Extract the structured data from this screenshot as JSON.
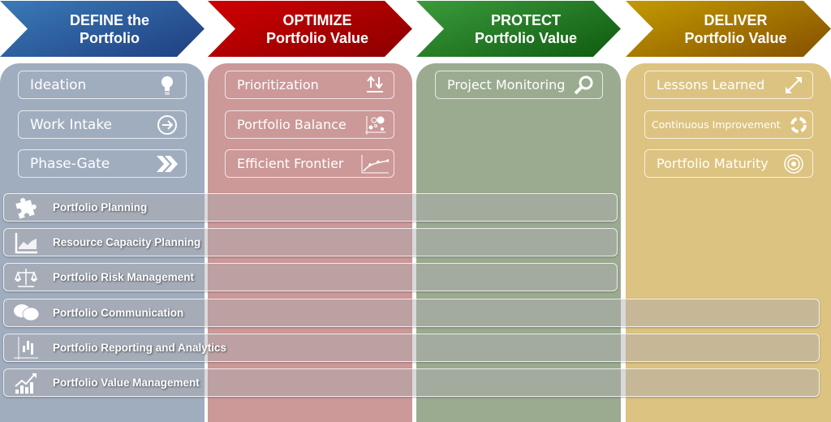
{
  "phases": [
    {
      "line1": "DEFINE the",
      "line2": "Portfolio",
      "color": "#2c5a9a",
      "panel": "#a0adbf",
      "items": [
        "Ideation",
        "Work Intake",
        "Phase-Gate"
      ],
      "icons": [
        "lightbulb-icon",
        "arrow-circle-right-icon",
        "double-chevron-right-icon"
      ]
    },
    {
      "line1": "OPTIMIZE",
      "line2": "Portfolio Value",
      "color": "#b00000",
      "panel": "#cc9898",
      "items": [
        "Prioritization",
        "Portfolio Balance",
        "Efficient Frontier"
      ],
      "icons": [
        "sort-arrows-icon",
        "bubble-chart-icon",
        "frontier-curve-icon"
      ]
    },
    {
      "line1": "PROTECT",
      "line2": "Portfolio Value",
      "color": "#1f7a1f",
      "panel": "#9bab90",
      "items": [
        "Project Monitoring"
      ],
      "icons": [
        "magnifier-icon"
      ]
    },
    {
      "line1": "DELIVER",
      "line2": "Portfolio Value",
      "color": "#b08000",
      "panel": "#dcc381",
      "items": [
        "Lessons Learned",
        "Continuous Improvement",
        "Portfolio Maturity"
      ],
      "icons": [
        "expand-arrows-icon",
        "cycle-arrows-icon",
        "target-icon"
      ]
    }
  ],
  "bars": [
    {
      "label": "Portfolio Planning",
      "icon": "puzzle-icon"
    },
    {
      "label": "Resource Capacity Planning",
      "icon": "area-chart-icon"
    },
    {
      "label": "Portfolio Risk Management",
      "icon": "scales-icon"
    },
    {
      "label": "Portfolio Communication",
      "icon": "speech-bubbles-icon"
    },
    {
      "label": "Portfolio Reporting and Analytics",
      "icon": "bar-chart-icon"
    },
    {
      "label": "Portfolio Value Management",
      "icon": "growth-chart-icon"
    }
  ]
}
